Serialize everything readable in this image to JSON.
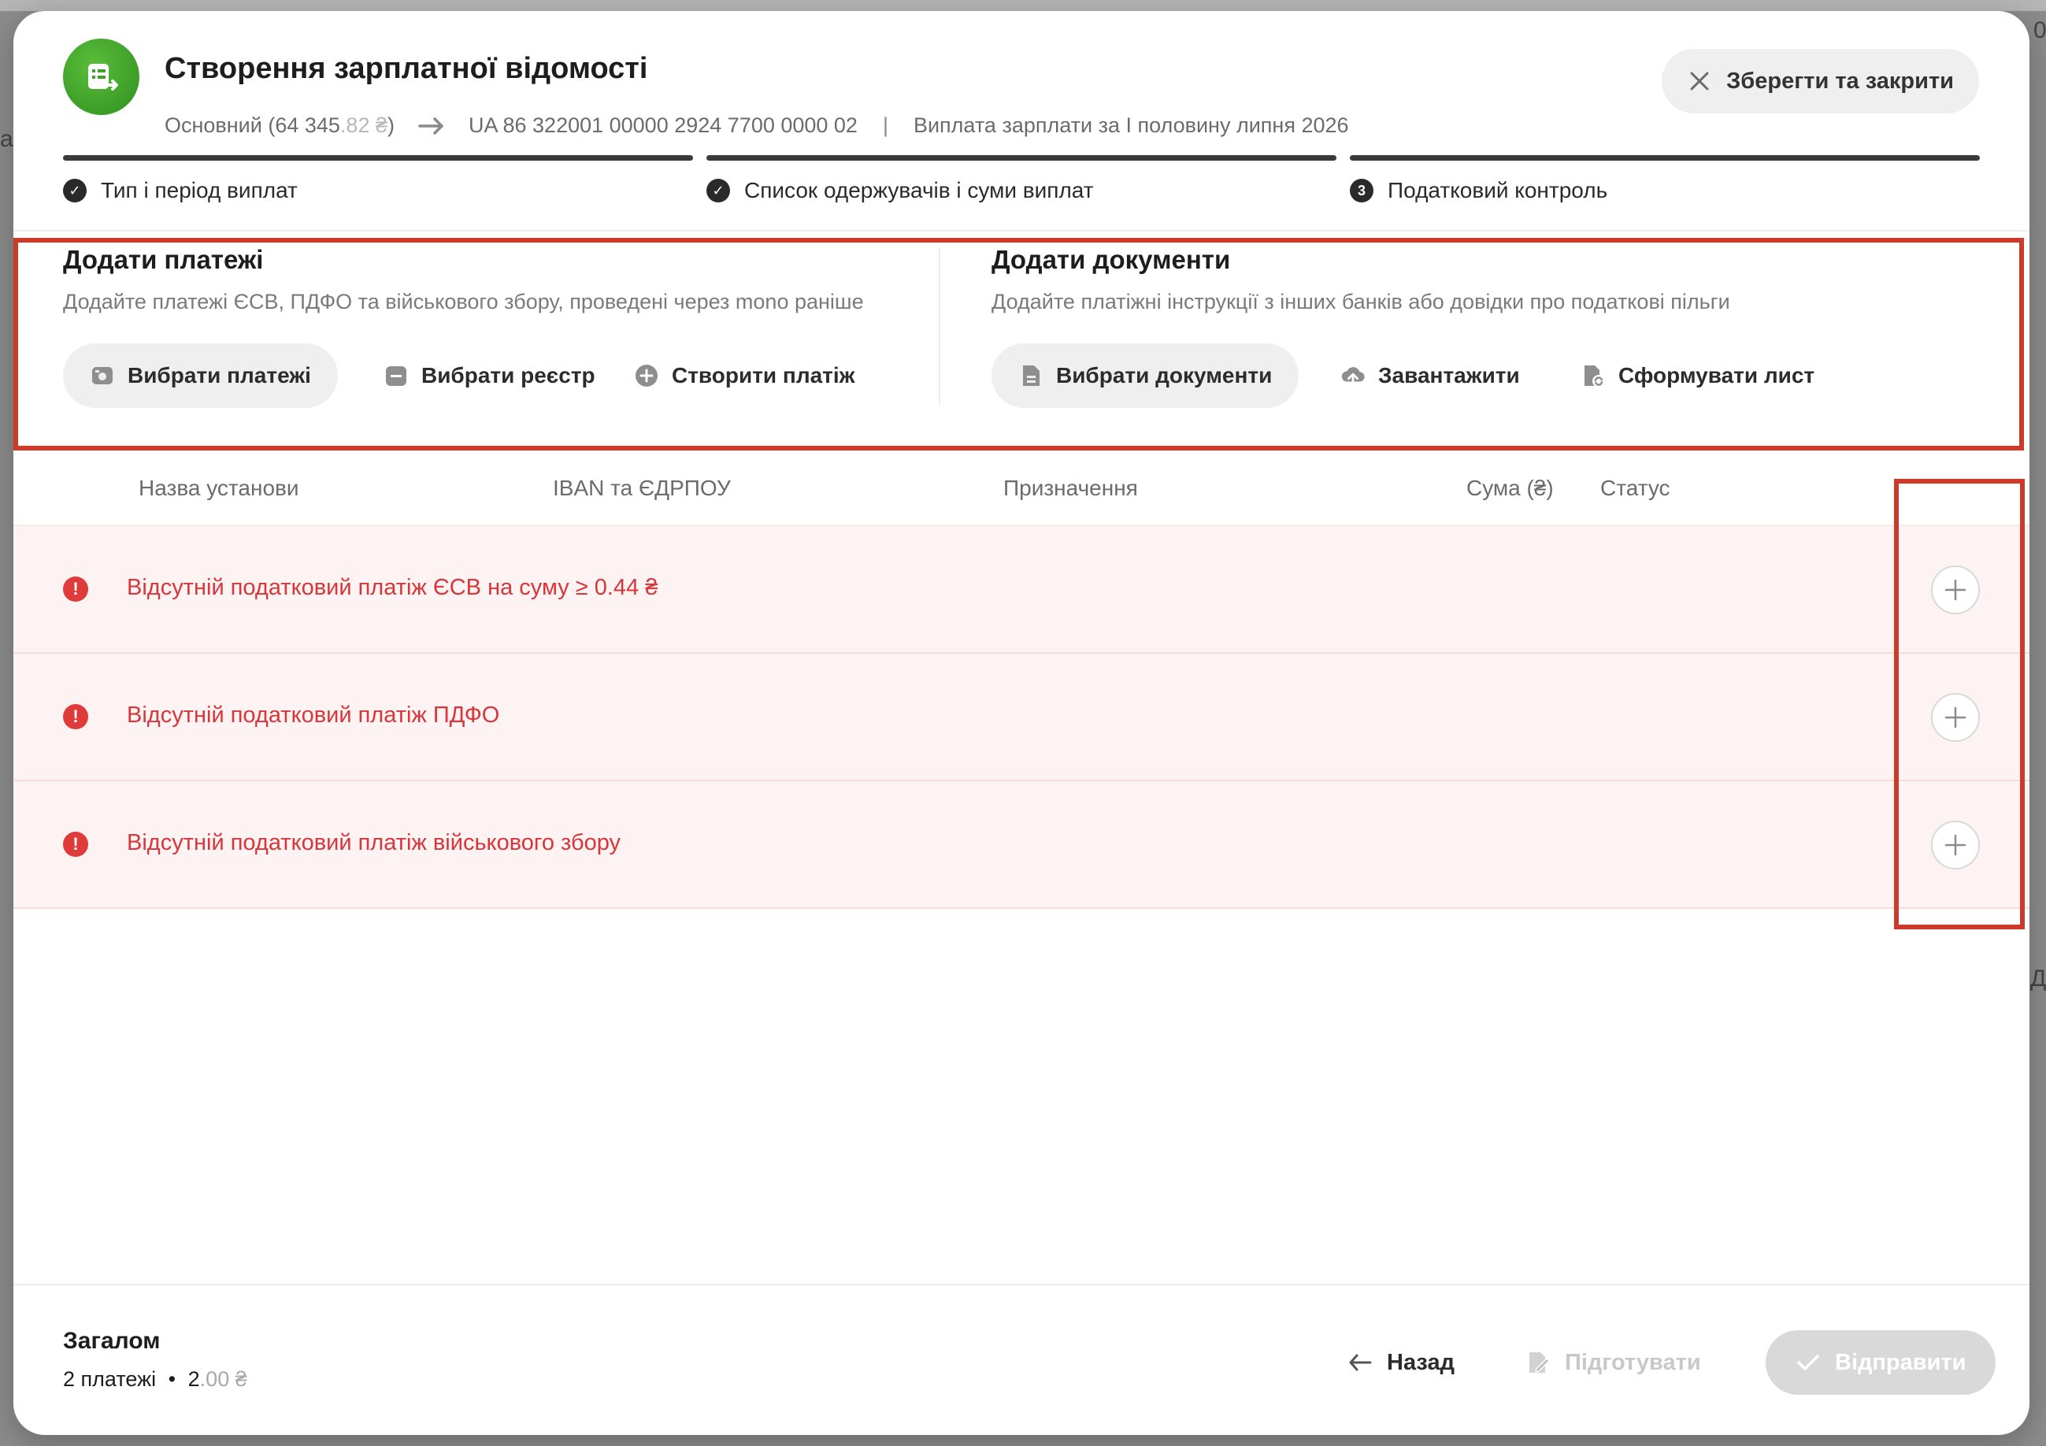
{
  "backdrop": {
    "left_text": "а",
    "right_text_top": "0",
    "right_text_mid": "Д"
  },
  "header": {
    "title": "Створення зарплатної відомості",
    "account": "Основний (64 345",
    "account_cents": ".82 ₴",
    "account_close": ")",
    "iban": "UA 86 322001 00000 2924 7700 0000 02",
    "separator": "|",
    "purpose": "Виплата зарплати за I половину липня 2026",
    "close_label": "Зберегти та закрити"
  },
  "steps": [
    {
      "label": "Тип і період виплат",
      "marker": "✓"
    },
    {
      "label": "Список одержувачів і суми виплат",
      "marker": "✓"
    },
    {
      "label": "Податковий контроль",
      "marker": "3"
    }
  ],
  "add_payments": {
    "title": "Додати платежі",
    "subtitle": "Додайте платежі ЄСВ, ПДФО та військового збору, проведені через mono раніше",
    "select_payments": "Вибрати платежі",
    "select_registry": "Вибрати реєстр",
    "create_payment": "Створити платіж"
  },
  "add_documents": {
    "title": "Додати документи",
    "subtitle": "Додайте платіжні інструкції з інших банків або довідки про податкові пільги",
    "select_documents": "Вибрати документи",
    "upload": "Завантажити",
    "generate_letter": "Сформувати лист"
  },
  "table": {
    "columns": [
      "Назва установи",
      "IBAN та ЄДРПОУ",
      "Призначення",
      "Сума (₴)",
      "Статус"
    ],
    "rows": [
      {
        "message": "Відсутній податковий платіж ЄСВ на суму ≥ 0.44 ₴"
      },
      {
        "message": "Відсутній податковий платіж ПДФО"
      },
      {
        "message": "Відсутній податковий платіж військового збору"
      }
    ]
  },
  "footer": {
    "total_title": "Загалом",
    "count": "2 платежі",
    "dot": "•",
    "amount_main": "2",
    "amount_cents": ".00 ₴",
    "back": "Назад",
    "prepare": "Підготувати",
    "send": "Відправити"
  },
  "colors": {
    "error": "#d8363a",
    "highlight": "#cc3a2a",
    "logo": "#3fa02a"
  }
}
